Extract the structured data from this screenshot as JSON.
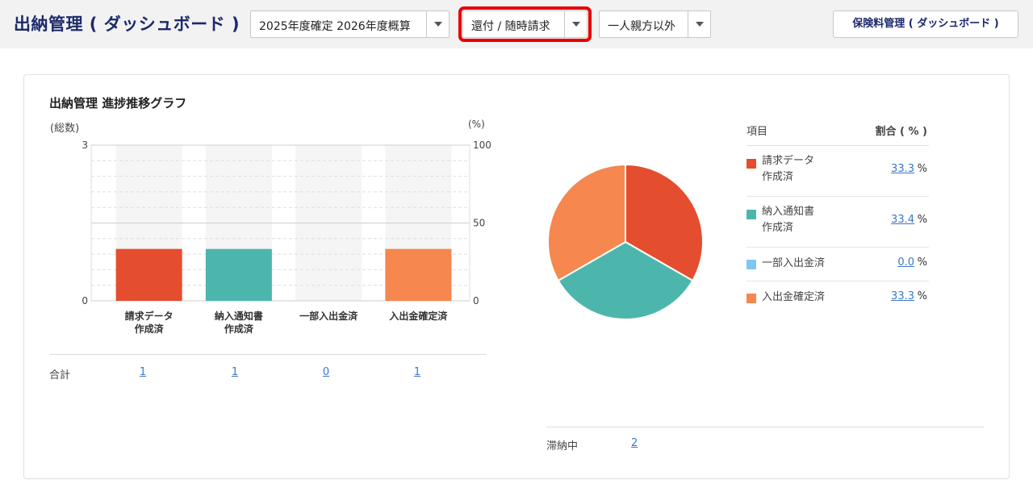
{
  "header": {
    "title": "出納管理 ( ダッシュボード )",
    "fiscal_select": "2025年度確定 2026年度概算",
    "type_select": "還付 / 随時請求",
    "parent_select": "一人親方以外",
    "dashboard_button": "保険料管理 ( ダッシュボード )"
  },
  "card": {
    "title": "出納管理 進捗推移グラフ",
    "totals_label": "合計",
    "totals": [
      "1",
      "1",
      "0",
      "1"
    ],
    "overdue_label": "滞納中",
    "overdue_value": "2"
  },
  "chart_data": [
    {
      "type": "bar",
      "categories": [
        [
          "請求データ",
          "作成済"
        ],
        [
          "納入通知書",
          "作成済"
        ],
        [
          "一部入出金済"
        ],
        [
          "入出金確定済"
        ]
      ],
      "values": [
        1,
        1,
        0,
        1
      ],
      "colors": [
        "#e44d2e",
        "#4db6ac",
        "#7ec8f0",
        "#f5874f"
      ],
      "ylabel": "(総数)",
      "ylabel_right": "(%)",
      "ylim": [
        0,
        3
      ],
      "ylim_right": [
        0,
        100
      ],
      "yticks": [
        "0",
        "3"
      ],
      "yticks_right": [
        "0",
        "50",
        "100"
      ],
      "grid": true
    },
    {
      "type": "pie",
      "labels": [
        "請求データ作成済",
        "納入通知書作成済",
        "一部入出金済",
        "入出金確定済"
      ],
      "values": [
        33.3,
        33.4,
        0.0,
        33.3
      ],
      "colors": [
        "#e44d2e",
        "#4db6ac",
        "#7ec8f0",
        "#f5874f"
      ]
    }
  ],
  "legend": {
    "header_item": "項目",
    "header_ratio": "割合 ( % )",
    "percent_sign": "%",
    "rows": [
      {
        "lines": [
          "請求データ",
          "作成済"
        ],
        "value": "33.3",
        "color": "#e44d2e"
      },
      {
        "lines": [
          "納入通知書",
          "作成済"
        ],
        "value": "33.4",
        "color": "#4db6ac"
      },
      {
        "lines": [
          "一部入出金済"
        ],
        "value": "0.0",
        "color": "#7ec8f0"
      },
      {
        "lines": [
          "入出金確定済"
        ],
        "value": "33.3",
        "color": "#f5874f"
      }
    ]
  }
}
